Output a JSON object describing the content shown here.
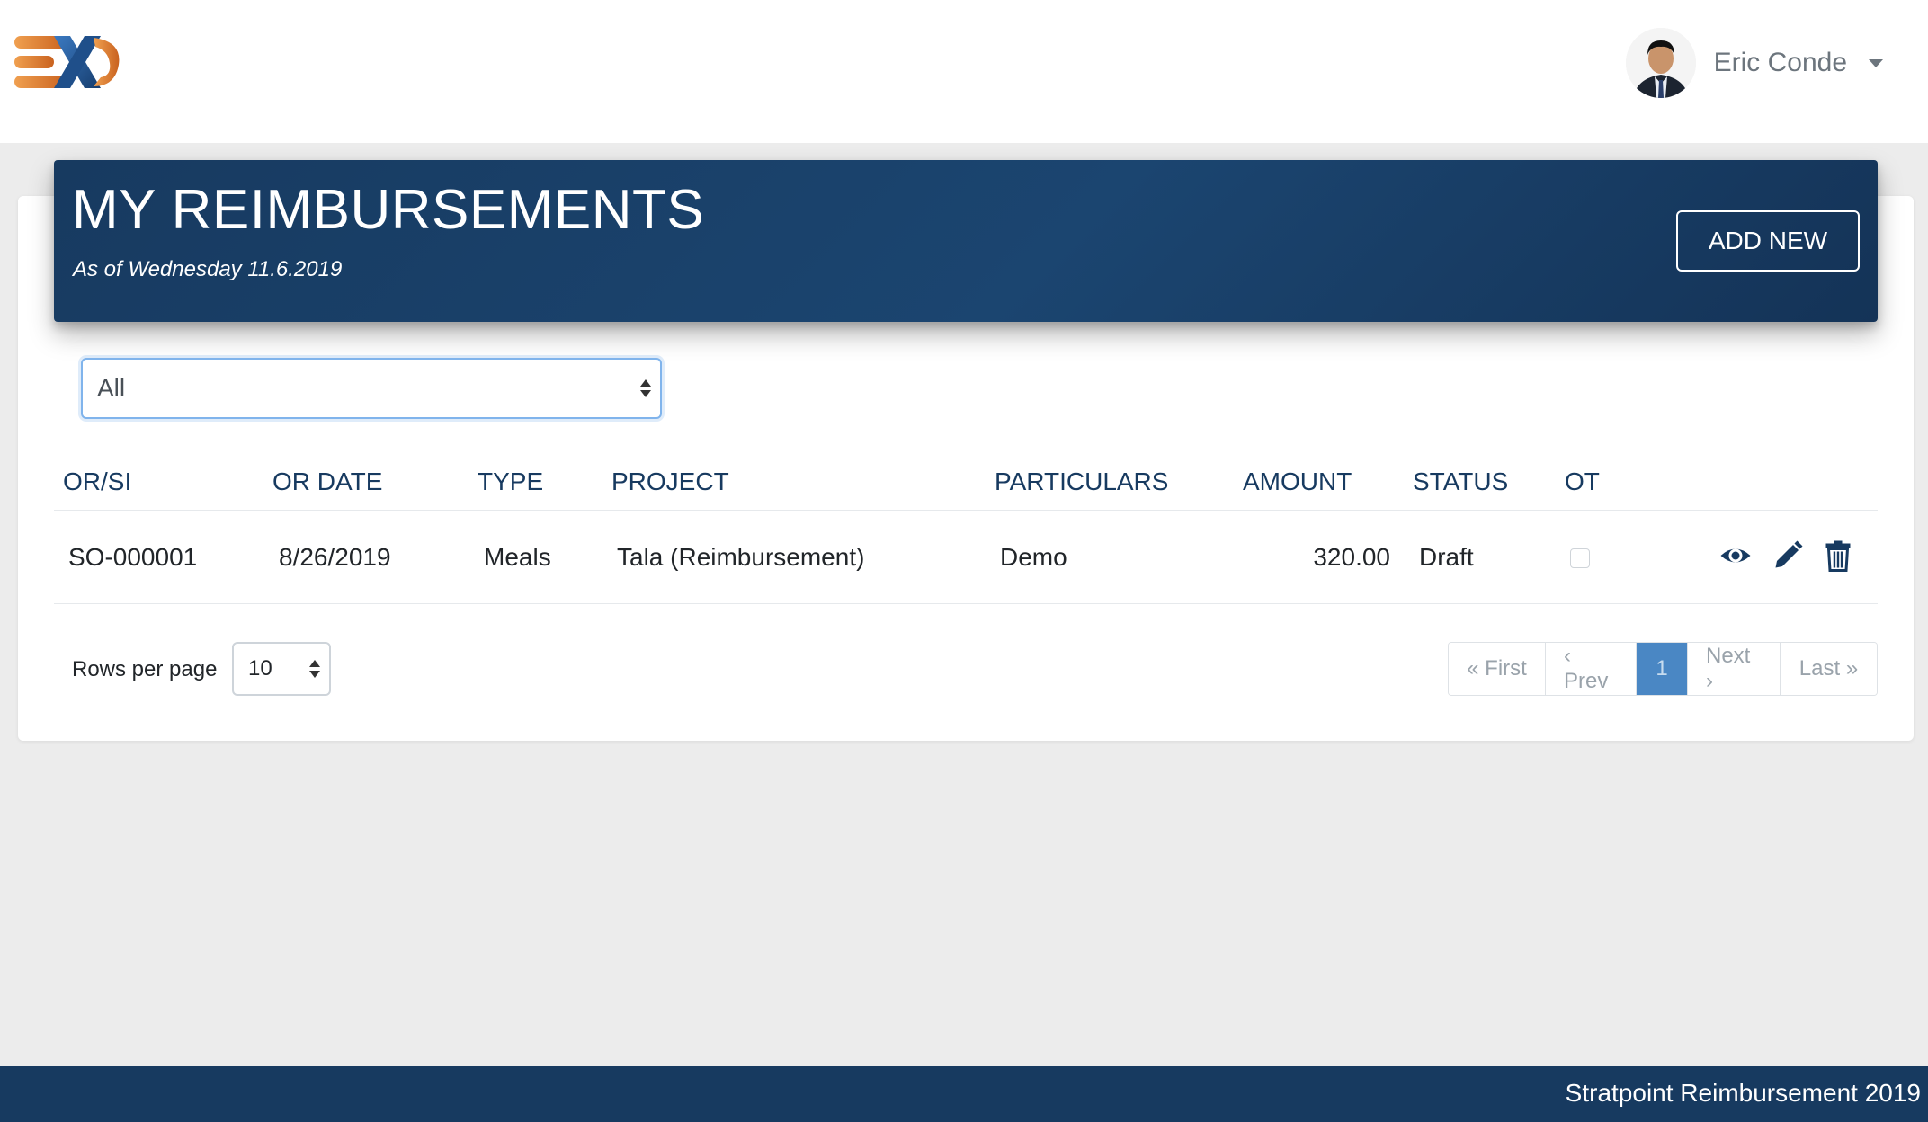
{
  "navbar": {
    "logo_icon": "ex-logo-icon",
    "user": {
      "name": "Eric Conde",
      "avatar_icon": "user-avatar"
    }
  },
  "header": {
    "title": "MY REIMBURSEMENTS",
    "subtitle": "As of Wednesday 11.6.2019",
    "add_new_label": "ADD NEW"
  },
  "filter": {
    "selected": "All"
  },
  "table": {
    "columns": [
      "OR/SI",
      "OR DATE",
      "TYPE",
      "PROJECT",
      "PARTICULARS",
      "AMOUNT",
      "STATUS",
      "OT"
    ],
    "rows": [
      {
        "or_si": "SO-000001",
        "or_date": "8/26/2019",
        "type": "Meals",
        "project": "Tala (Reimbursement)",
        "particulars": "Demo",
        "amount": "320.00",
        "status": "Draft",
        "ot": false
      }
    ],
    "action_icons": [
      "eye-icon",
      "pencil-icon",
      "trash-icon"
    ]
  },
  "pager": {
    "rows_label": "Rows per page",
    "rows_value": "10",
    "first": "« First",
    "prev": "‹ Prev",
    "current": "1",
    "next": "Next ›",
    "last": "Last »"
  },
  "footer": {
    "text": "Stratpoint Reimbursement 2019"
  },
  "colors": {
    "brand_navy": "#173a60",
    "logo_orange": "#e07a2b",
    "logo_blue": "#1f4f8a",
    "active_page": "#4a87c4"
  }
}
